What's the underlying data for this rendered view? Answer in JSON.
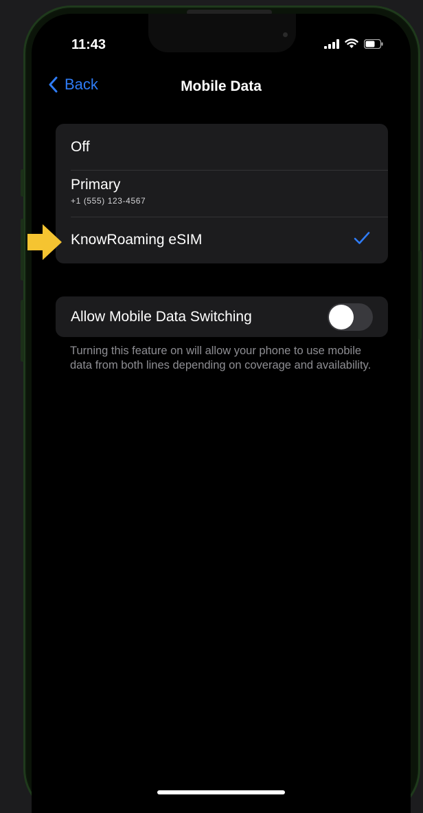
{
  "status_bar": {
    "time": "11:43",
    "icons": [
      "cellular-signal-icon",
      "wifi-icon",
      "battery-icon"
    ]
  },
  "nav": {
    "back_label": "Back",
    "title": "Mobile Data"
  },
  "options": {
    "off_label": "Off",
    "primary_label": "Primary",
    "primary_number": "+1 (555) 123-4567",
    "esim_label": "KnowRoaming eSIM",
    "selected": "KnowRoaming eSIM"
  },
  "switching": {
    "label": "Allow Mobile Data Switching",
    "enabled": false,
    "footnote": "Turning this feature on will allow your phone to use mobile data from both lines depending on coverage and availability."
  },
  "colors": {
    "accent": "#2f7cf6",
    "arrow": "#f5c431",
    "cell_background": "#1c1c1e"
  }
}
